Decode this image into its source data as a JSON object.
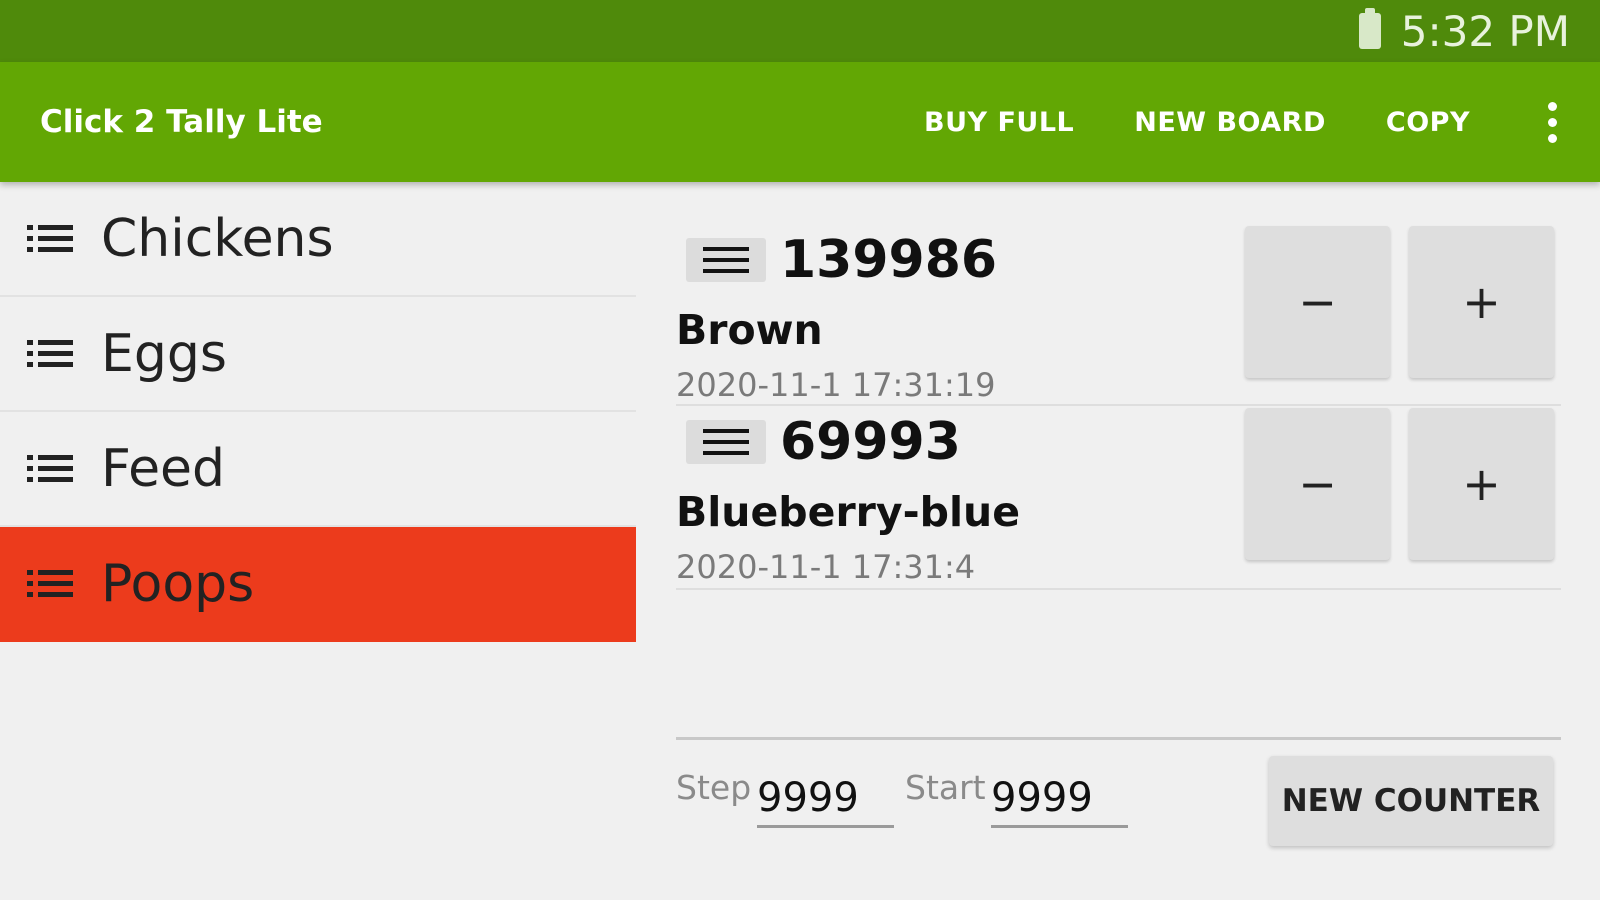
{
  "status_bar": {
    "time": "5:32 PM",
    "battery_icon": "battery-icon"
  },
  "app_bar": {
    "title": "Click 2 Tally Lite",
    "actions": [
      "BUY FULL",
      "NEW BOARD",
      "COPY"
    ],
    "overflow_icon": "more-vert-icon"
  },
  "sidebar": {
    "items": [
      {
        "label": "Chickens",
        "active": false
      },
      {
        "label": "Eggs",
        "active": false
      },
      {
        "label": "Feed",
        "active": false
      },
      {
        "label": "Poops",
        "active": true
      }
    ],
    "icon": "list-icon"
  },
  "counters": [
    {
      "count": "139986",
      "name": "Brown",
      "timestamp": "2020-11-1 17:31:19",
      "minus": "−",
      "plus": "+"
    },
    {
      "count": "69993",
      "name": "Blueberry-blue",
      "timestamp": "2020-11-1 17:31:4",
      "minus": "−",
      "plus": "+"
    }
  ],
  "bottom": {
    "step_label": "Step",
    "step_value": "9999",
    "start_label": "Start",
    "start_value": "9999",
    "new_counter_label": "NEW COUNTER"
  },
  "colors": {
    "status_bar": "#4f8a0b",
    "app_bar": "#62a704",
    "active_item": "#ec3b1c",
    "background": "#f0f0f0"
  }
}
